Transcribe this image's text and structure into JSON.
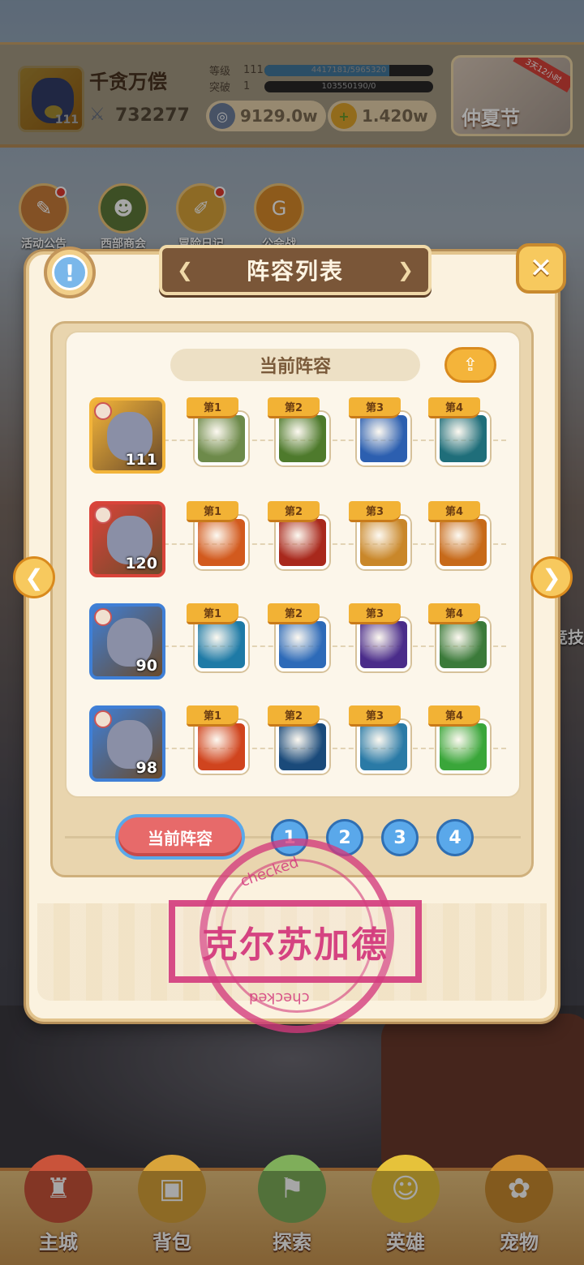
{
  "player": {
    "name": "千贪万偿",
    "level": "111",
    "power": "732277",
    "rank_label": "等级",
    "rank_num": "111",
    "rank_progress_text": "4417181/5965320",
    "rank_progress": 0.74,
    "break_label": "突破",
    "break_num": "1",
    "break_progress_text": "103550190/0",
    "break_progress": 0.0
  },
  "currencies": {
    "gems": "9129.0w",
    "gold": "1.420w"
  },
  "festival": {
    "label": "仲夏节",
    "badge": "3天12小时"
  },
  "activities": [
    "活动公告",
    "西部商会",
    "冒险日记",
    "公会战"
  ],
  "modal": {
    "title": "阵容列表",
    "current_header": "当前阵容",
    "tabs": {
      "current": "当前阵容",
      "nums": [
        "1",
        "2",
        "3",
        "4"
      ]
    }
  },
  "lineup": [
    {
      "hero_level": "111",
      "hero_color": "#f2b43a",
      "skills": [
        {
          "tag": "第1",
          "color": "#6d8a4a"
        },
        {
          "tag": "第2",
          "color": "#4e7a2c"
        },
        {
          "tag": "第3",
          "color": "#2c5fb0"
        },
        {
          "tag": "第4",
          "color": "#1f6e7a"
        }
      ]
    },
    {
      "hero_level": "120",
      "hero_color": "#d9443a",
      "skills": [
        {
          "tag": "第1",
          "color": "#d25a1e"
        },
        {
          "tag": "第2",
          "color": "#a8281c"
        },
        {
          "tag": "第3",
          "color": "#c9872a"
        },
        {
          "tag": "第4",
          "color": "#c76a1a"
        }
      ]
    },
    {
      "hero_level": "90",
      "hero_color": "#3f7fd6",
      "skills": [
        {
          "tag": "第1",
          "color": "#1e7aa6"
        },
        {
          "tag": "第2",
          "color": "#2d6ab8"
        },
        {
          "tag": "第3",
          "color": "#4a2c8a"
        },
        {
          "tag": "第4",
          "color": "#3b7a3a"
        }
      ]
    },
    {
      "hero_level": "98",
      "hero_color": "#3f7fd6",
      "skills": [
        {
          "tag": "第1",
          "color": "#d0441e"
        },
        {
          "tag": "第2",
          "color": "#1a4a7a"
        },
        {
          "tag": "第3",
          "color": "#2a7aa6"
        },
        {
          "tag": "第4",
          "color": "#3aa63a"
        }
      ]
    }
  ],
  "stamp": {
    "text": "克尔苏加德",
    "ring_top": "checked",
    "ring_bottom": "checked"
  },
  "side_labels": [
    "竞技"
  ],
  "bottom_nav": [
    "主城",
    "背包",
    "探索",
    "英雄",
    "宠物"
  ]
}
